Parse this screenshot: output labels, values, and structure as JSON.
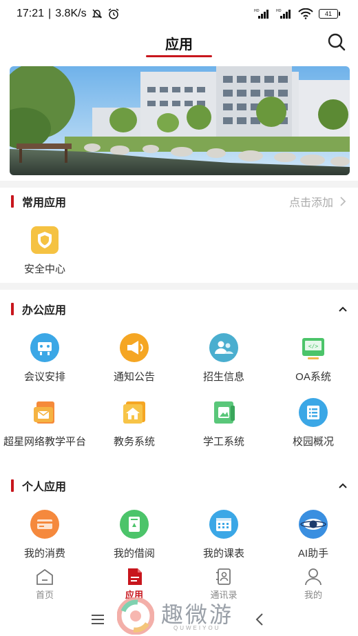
{
  "status_bar": {
    "time": "17:21",
    "speed": "3.8K/s",
    "battery": "41"
  },
  "header": {
    "title": "应用"
  },
  "sections": {
    "common": {
      "title": "常用应用",
      "action": "点击添加",
      "items": [
        {
          "label": "安全中心",
          "icon": "shield-icon"
        }
      ]
    },
    "office": {
      "title": "办公应用",
      "items": [
        {
          "label": "会议安排",
          "icon": "meeting-icon"
        },
        {
          "label": "通知公告",
          "icon": "megaphone-icon"
        },
        {
          "label": "招生信息",
          "icon": "enrollment-icon"
        },
        {
          "label": "OA系统",
          "icon": "oa-icon"
        },
        {
          "label": "超星网络教学平台",
          "icon": "mail-icon"
        },
        {
          "label": "教务系统",
          "icon": "house-icon"
        },
        {
          "label": "学工系统",
          "icon": "picture-icon"
        },
        {
          "label": "校园概况",
          "icon": "list-icon"
        }
      ]
    },
    "personal": {
      "title": "个人应用",
      "items": [
        {
          "label": "我的消费",
          "icon": "card-icon"
        },
        {
          "label": "我的借阅",
          "icon": "book-icon"
        },
        {
          "label": "我的课表",
          "icon": "calendar-icon"
        },
        {
          "label": "AI助手",
          "icon": "eye-icon"
        }
      ]
    }
  },
  "tabs": [
    {
      "label": "首页",
      "icon": "home-icon"
    },
    {
      "label": "应用",
      "icon": "apps-icon",
      "active": true
    },
    {
      "label": "通讯录",
      "icon": "contacts-icon"
    },
    {
      "label": "我的",
      "icon": "person-icon"
    }
  ],
  "watermark": {
    "text": "趣微游",
    "sub": "QUWEIYOU"
  },
  "colors": {
    "accent": "#c8161d",
    "icon_orange": "#f5a623",
    "icon_blue": "#3ba7e6",
    "icon_green": "#4cc46a"
  }
}
